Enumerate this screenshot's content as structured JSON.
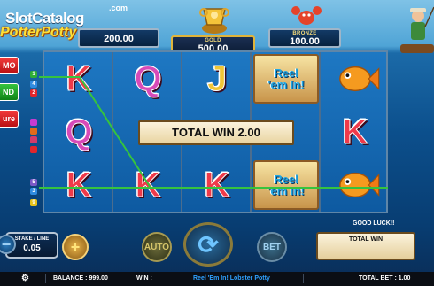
{
  "logo": {
    "line1": "SlotCatalog",
    "line2": "PotterPotty",
    "domain": ".com"
  },
  "jackpots": {
    "left_value": "200.00",
    "gold_label": "GOLD",
    "gold_value": "500.00",
    "bronze_label": "BRONZE",
    "bronze_value": "100.00"
  },
  "menu": {
    "tab_1": "MO",
    "tab_2": "ND",
    "tab_3": "ure"
  },
  "reels": [
    [
      "K",
      "Q",
      "K"
    ],
    [
      "Q",
      "",
      "K"
    ],
    [
      "J",
      "",
      "K"
    ],
    [
      "Reel 'em In!",
      "",
      "Reel 'em In!"
    ],
    [
      "fish",
      "K",
      "fish"
    ]
  ],
  "reel_tile_text": {
    "line1": "Reel",
    "line2": "'em In!"
  },
  "paylines_left": [
    "1",
    "4",
    "2",
    "",
    "",
    "",
    "",
    "5",
    "3",
    "9"
  ],
  "popup": {
    "total_win_text": "TOTAL WIN 2.00"
  },
  "status_message": "GOOD LUCK!!",
  "total_win_box": {
    "label": "TOTAL WIN",
    "value": ""
  },
  "stake": {
    "label": "STAKE / LINE",
    "value": "0.05"
  },
  "buttons": {
    "minus": "−",
    "plus": "+",
    "spin": "⟳",
    "autoplay": "AUTO",
    "maxbet": "BET"
  },
  "statusbar": {
    "gear": "⚙",
    "balance": "BALANCE : 999.00",
    "win": "WIN :",
    "game_title": "Reel 'Em In! Lobster Potty",
    "total_bet": "TOTAL BET : 1.00"
  },
  "colors": {
    "win_line": "#36c33e",
    "win_line_2": "#ffd83a",
    "accent_red": "#e2262c",
    "accent_green": "#2fae34"
  }
}
